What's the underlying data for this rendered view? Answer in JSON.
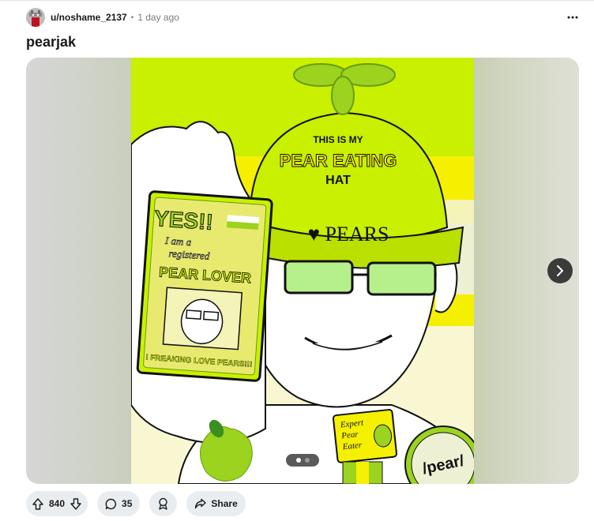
{
  "post": {
    "author": "u/noshame_2137",
    "separator": "•",
    "time": "1 day ago",
    "title": "pearjak"
  },
  "media": {
    "hat_line1": "THIS IS MY",
    "hat_line2": "PEAR EATING",
    "hat_line3": "HAT",
    "hat_band": "♥ PEARS",
    "card_yes": "YES!!",
    "card_line1": "I am a",
    "card_line2": "registered",
    "card_line3": "PEAR LOVER",
    "card_footer": "I FREAKING LOVE PEARS!!!",
    "badge_line1": "Expert",
    "badge_line2": "Pear",
    "badge_line3": "Eater",
    "button_text": "/pear/",
    "current_page": 1,
    "page_count": 2
  },
  "actions": {
    "upvotes": "840",
    "comments": "35",
    "share_label": "Share"
  },
  "colors": {
    "lime": "#c8f000",
    "yellow": "#f5f000",
    "light_yellow": "#f4f3b8",
    "pear_green": "#9bd31f",
    "button_bg": "#eaedef"
  },
  "icons": [
    "more-horizontal-icon",
    "chevron-right-icon",
    "upvote-icon",
    "downvote-icon",
    "comment-icon",
    "award-icon",
    "share-icon"
  ]
}
